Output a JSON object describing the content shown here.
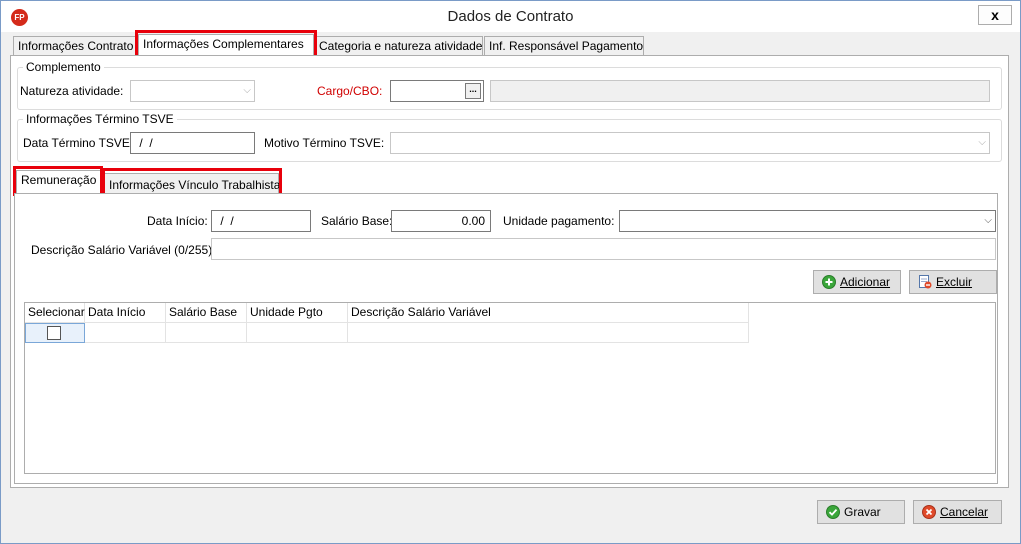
{
  "window": {
    "title": "Dados de Contrato",
    "app_icon": "FP",
    "close_label": "x"
  },
  "tabs": [
    {
      "label": "Informações Contrato"
    },
    {
      "label": "Informações Complementares"
    },
    {
      "label": "Categoria e natureza atividade"
    },
    {
      "label": "Inf. Responsável Pagamento"
    }
  ],
  "complemento": {
    "group_title": "Complemento",
    "natureza_label": "Natureza atividade:",
    "natureza_value": "",
    "cargo_label": "Cargo/CBO:",
    "cargo_value": "",
    "cargo_desc": "",
    "ellipsis": "..."
  },
  "termino": {
    "group_title": "Informações Término TSVE",
    "data_label": "Data Término TSVE:",
    "data_value": " /  /",
    "motivo_label": "Motivo Término TSVE:",
    "motivo_value": ""
  },
  "subtabs": [
    {
      "label": "Remuneração"
    },
    {
      "label": "Informações Vínculo Trabalhista"
    }
  ],
  "remuneracao": {
    "data_inicio_label": "Data Início:",
    "data_inicio_value": " /  /",
    "salario_label": "Salário Base:",
    "salario_value": "0.00",
    "unidade_label": "Unidade pagamento:",
    "unidade_value": "",
    "descricao_label": "Descrição Salário Variável (0/255):",
    "descricao_value": "",
    "adicionar_label": "Adicionar",
    "excluir_label": "Excluir"
  },
  "grid": {
    "columns": [
      "Selecionar",
      "Data Início",
      "Salário Base",
      "Unidade Pgto",
      "Descrição Salário Variável"
    ],
    "rows": [
      {
        "selecionar": false,
        "data_inicio": "",
        "salario_base": "",
        "unidade_pgto": "",
        "descricao": ""
      }
    ]
  },
  "footer": {
    "gravar_label": "Gravar",
    "cancelar_label": "Cancelar"
  },
  "colors": {
    "highlight": "#e8000b",
    "required_label": "#d00000",
    "app_icon": "#d42a1a"
  }
}
